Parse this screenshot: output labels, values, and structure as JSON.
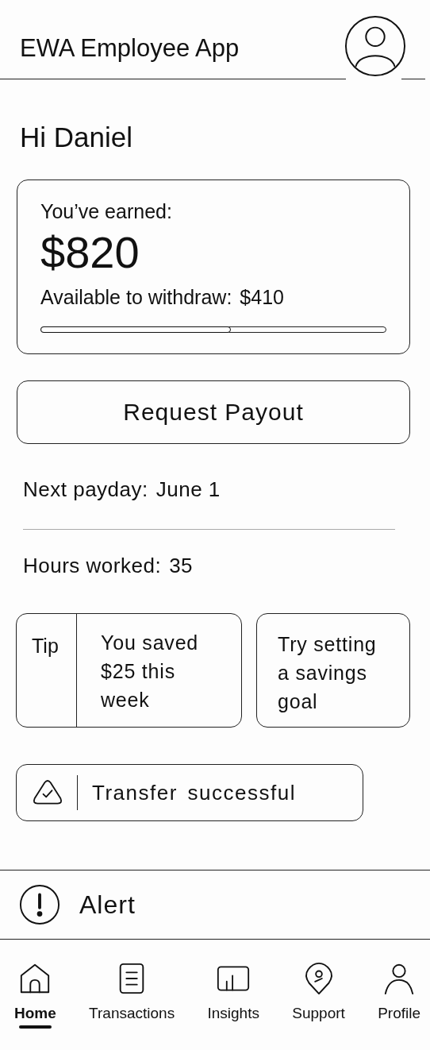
{
  "header": {
    "title": "EWA Employee App"
  },
  "greeting": "Hi Daniel",
  "earnings": {
    "label": "You’ve earned:",
    "amount": "$820",
    "available_label": "Available to withdraw:",
    "available_amount": "$410",
    "level": 0.55
  },
  "payout_button": "Request Payout",
  "next_payday": {
    "label": "Next payday:",
    "value": "June 1"
  },
  "hours_worked": {
    "label": "Hours worked:",
    "value": "35"
  },
  "tips": [
    {
      "kind": "labeled",
      "label": "Tip",
      "text": "You saved $25 this week"
    },
    {
      "kind": "plain",
      "text": "Try setting a savings goal"
    }
  ],
  "toast": {
    "text": "Transfer successful"
  },
  "alert": {
    "text": "Alert"
  },
  "nav": [
    {
      "label": "Home",
      "selected": true
    },
    {
      "label": "Transactions",
      "selected": false
    },
    {
      "label": "Insights",
      "selected": false
    },
    {
      "label": "Support",
      "selected": false
    },
    {
      "label": "Profile",
      "selected": false
    }
  ]
}
